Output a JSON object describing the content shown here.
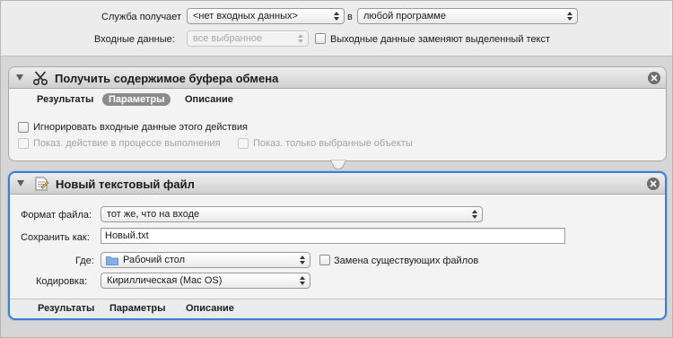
{
  "service": {
    "receives_label": "Служба получает",
    "input_type": "<нет входных данных>",
    "in_label": "в",
    "app": "любой программе",
    "input_data_label": "Входные данные:",
    "input_data_value": "все выбранное",
    "replace_label": "Выходные данные заменяют выделенный текст"
  },
  "action1": {
    "title": "Получить содержимое буфера обмена",
    "tabs": [
      "Результаты",
      "Параметры",
      "Описание"
    ],
    "active_tab": "Параметры",
    "ignore_input": "Игнорировать входные данные этого действия",
    "show_action": "Показ. действие в процессе выполнения",
    "show_selected": "Показ. только выбранные объекты"
  },
  "action2": {
    "title": "Новый текстовый файл",
    "format_label": "Формат файла:",
    "format_value": "тот же, что на входе",
    "save_as_label": "Сохранить как:",
    "save_as_value": "Новый.txt",
    "where_label": "Где:",
    "where_value": "Рабочий стол",
    "replace_files": "Замена существующих файлов",
    "encoding_label": "Кодировка:",
    "encoding_value": "Кириллическая (Mac OS)",
    "tabs": [
      "Результаты",
      "Параметры",
      "Описание"
    ]
  },
  "icons": {
    "action1": "scissors-icon",
    "action2": "text-file-icon",
    "close": "close-circle-icon",
    "folder": "folder-icon"
  },
  "colors": {
    "selected_border": "#3c7fd8",
    "active_tab": "#8b8b8b"
  }
}
